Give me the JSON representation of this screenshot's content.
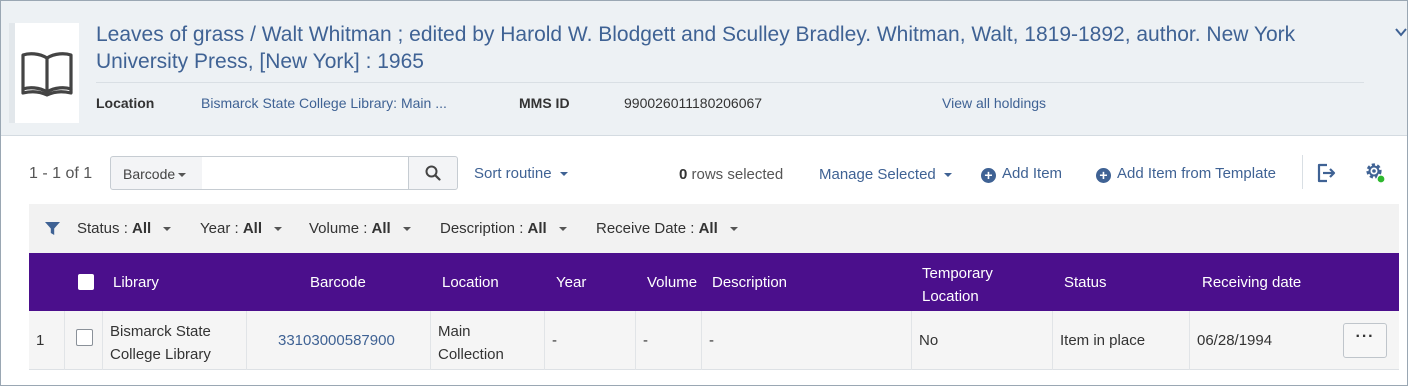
{
  "record": {
    "title": "Leaves of grass / Walt Whitman ; edited by Harold W. Blodgett and Sculley Bradley. Whitman, Walt, 1819-1892, author. New York University Press, [New York] : 1965",
    "location_label": "Location",
    "location_value": "Bismarck State College Library: Main ...",
    "mms_label": "MMS ID",
    "mms_value": "990026011180206067",
    "view_all_holdings": "View all holdings"
  },
  "toolbar": {
    "count": "1 - 1 of 1",
    "search_field": "Barcode",
    "search_value": "",
    "sort": "Sort routine",
    "rows_selected_count": "0",
    "rows_selected_label": "rows selected",
    "manage_selected": "Manage Selected",
    "add_item": "Add Item",
    "add_from_template": "Add Item from Template"
  },
  "filters": [
    {
      "label": "Status :",
      "value": "All"
    },
    {
      "label": "Year :",
      "value": "All"
    },
    {
      "label": "Volume :",
      "value": "All"
    },
    {
      "label": "Description :",
      "value": "All"
    },
    {
      "label": "Receive Date :",
      "value": "All"
    }
  ],
  "table": {
    "columns": [
      "Library",
      "Barcode",
      "Location",
      "Year",
      "Volume",
      "Description",
      "Temporary Location",
      "Status",
      "Receiving date"
    ],
    "rows": [
      {
        "index": "1",
        "library": "Bismarck State College Library",
        "barcode": "33103000587900",
        "location": "Main Collection",
        "year": "-",
        "volume": "-",
        "description": "-",
        "temporary_location": "No",
        "status": "Item in place",
        "receiving_date": "06/28/1994",
        "actions": "···"
      }
    ]
  },
  "colors": {
    "header_purple": "#4b0f8c",
    "link_blue": "#3f6294",
    "status_dot": "#2eb82e"
  },
  "icons": [
    "book-icon",
    "chevron-down-icon",
    "search-icon",
    "filter-icon",
    "plus-circle-icon",
    "export-icon",
    "settings-gear-icon"
  ]
}
